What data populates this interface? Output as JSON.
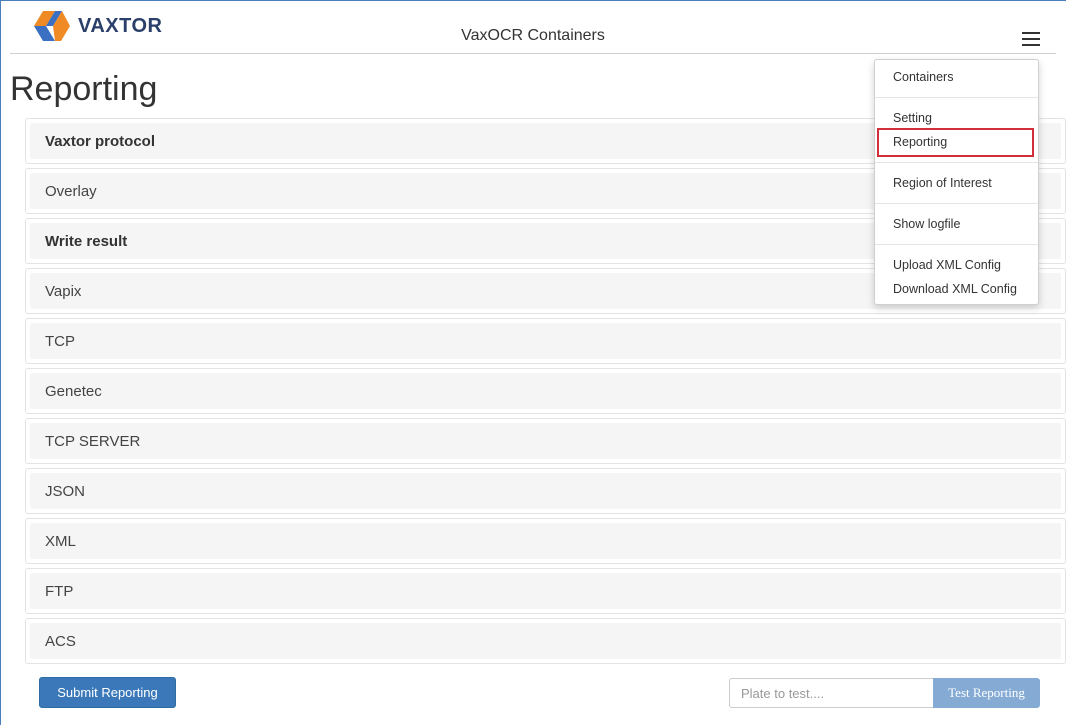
{
  "app": {
    "logo_text": "VAXTOR",
    "title": "VaxOCR Containers"
  },
  "page": {
    "title": "Reporting"
  },
  "sections": [
    {
      "label": "Vaxtor protocol",
      "bold": true
    },
    {
      "label": "Overlay",
      "bold": false
    },
    {
      "label": "Write result",
      "bold": true
    },
    {
      "label": "Vapix",
      "bold": false
    },
    {
      "label": "TCP",
      "bold": false
    },
    {
      "label": "Genetec",
      "bold": false
    },
    {
      "label": "TCP SERVER",
      "bold": false
    },
    {
      "label": "JSON",
      "bold": false
    },
    {
      "label": "XML",
      "bold": false
    },
    {
      "label": "FTP",
      "bold": false
    },
    {
      "label": "ACS",
      "bold": false
    }
  ],
  "footer": {
    "submit_label": "Submit Reporting",
    "plate_placeholder": "Plate to test....",
    "test_label": "Test Reporting"
  },
  "menu": {
    "items": [
      {
        "label": "Containers"
      },
      {
        "label": "Setting"
      },
      {
        "label": "Reporting"
      },
      {
        "label": "Region of Interest"
      },
      {
        "label": "Show logfile"
      },
      {
        "label": "Upload XML Config"
      },
      {
        "label": "Download XML Config"
      }
    ],
    "active_index": 2
  },
  "colors": {
    "primary": "#3a78b9",
    "test_button": "#85abd5",
    "highlight": "#d32f3a",
    "logo_orange": "#f08a24",
    "logo_blue": "#3b6fc2"
  },
  "icons": {
    "menu": "hamburger-icon",
    "logo": "vaxtor-logo"
  }
}
